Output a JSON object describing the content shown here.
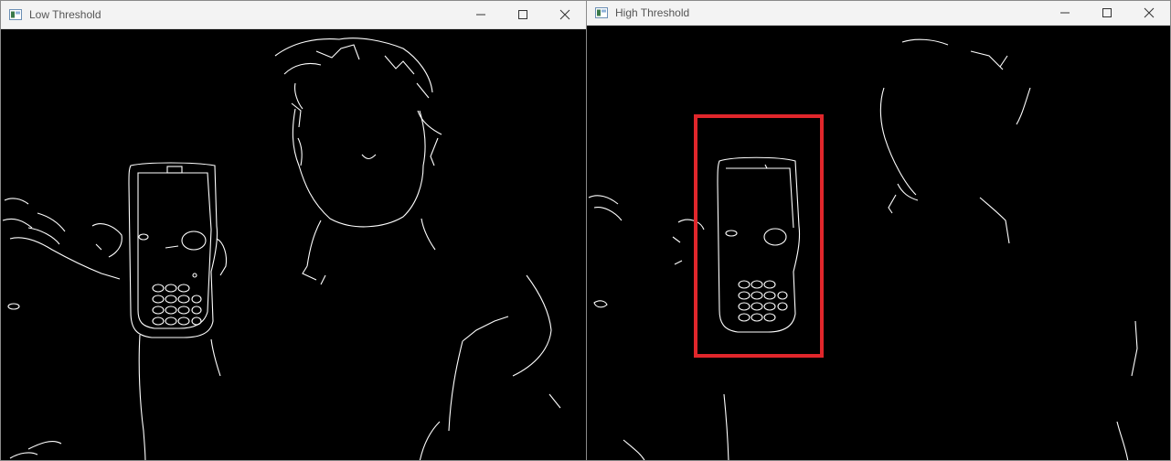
{
  "windows": [
    {
      "title": "Low Threshold"
    },
    {
      "title": "High Threshold"
    }
  ],
  "colors": {
    "highlight": "#e0262b",
    "image_bg": "#000000",
    "edges": "#ffffff",
    "titlebar": "#f3f3f3"
  },
  "icons": {
    "app": "window-app-icon",
    "minimize": "minimize-icon",
    "maximize": "maximize-icon",
    "close": "close-icon"
  }
}
